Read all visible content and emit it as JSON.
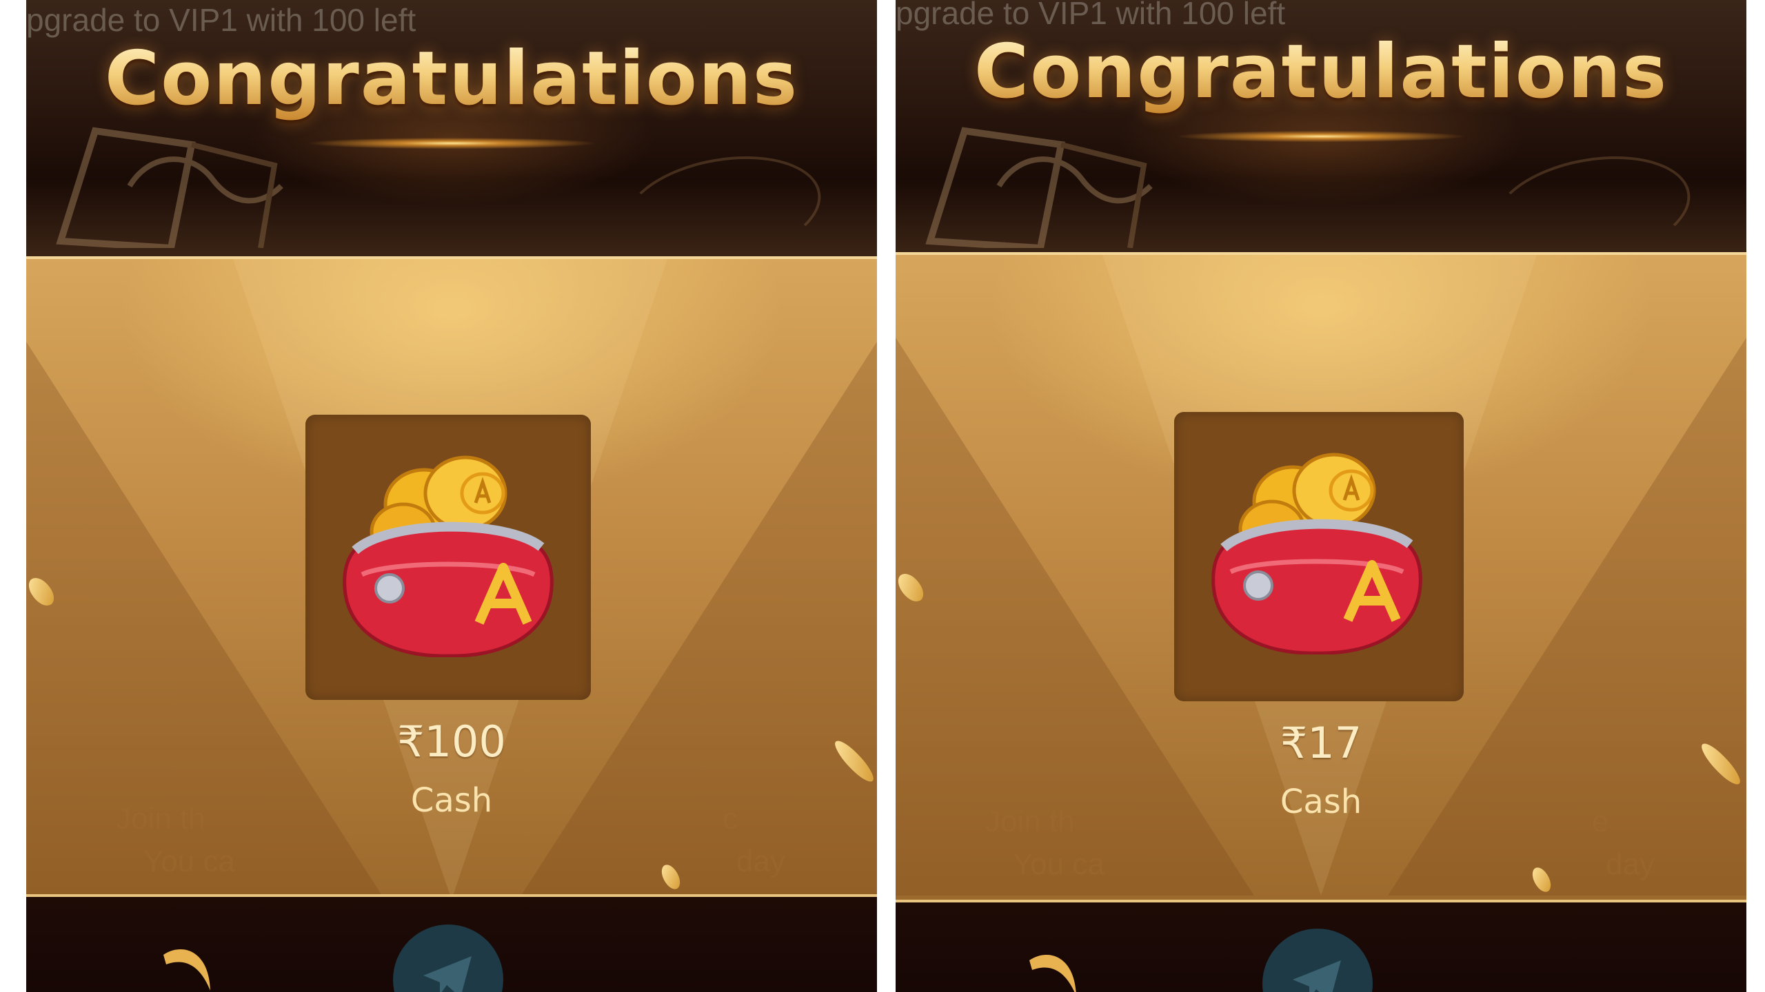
{
  "background_text": "pgrade to VIP1 with 100 left",
  "panels": [
    {
      "title": "Congratulations",
      "reward_amount": "₹100",
      "reward_type": "Cash",
      "faint_line_1a": "Join th",
      "faint_line_1b": "c",
      "faint_line_2a": "You ca",
      "faint_line_2b": "day"
    },
    {
      "title": "Congratulations",
      "reward_amount": "₹17",
      "reward_type": "Cash",
      "faint_line_1a": "Join th",
      "faint_line_1b": "e",
      "faint_line_2a": "You ca",
      "faint_line_2b": "day"
    }
  ],
  "icons": {
    "reward": "coin-purse-icon",
    "bottom": "telegram-icon"
  },
  "colors": {
    "title_gold": "#f6d58c",
    "card_gold": "#c08a45",
    "item_box": "#7a4a1a",
    "amount_text": "#fbecc4",
    "purse_red": "#d9263a",
    "coin_gold": "#f3b623"
  }
}
